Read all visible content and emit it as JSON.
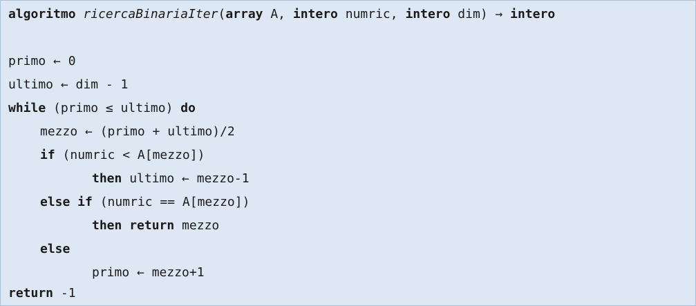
{
  "code": {
    "signature": {
      "kw_algoritmo": "algoritmo",
      "name": "ricercaBinariaIter",
      "open_paren": "(",
      "kw_array": "array",
      "p1_name": " A, ",
      "kw_intero1": "intero",
      "p2_name": " numric, ",
      "kw_intero2": "intero",
      "p3_name": " dim) → ",
      "kw_intero_ret": "intero"
    },
    "line_primo": "primo ← 0",
    "line_ultimo": "ultimo ← dim - 1",
    "while_line": {
      "kw_while": "while",
      "cond": " (primo ≤ ultimo) ",
      "kw_do": "do"
    },
    "line_mezzo": "mezzo ← (primo + ultimo)/2",
    "if_line": {
      "kw_if": "if",
      "cond": " (numric < A[mezzo])"
    },
    "then1_line": {
      "kw_then": "then",
      "stmt": " ultimo ← mezzo-1"
    },
    "elseif_line": {
      "kw_else_if": "else if",
      "cond": " (numric == A[mezzo])"
    },
    "then2_line": {
      "kw_then": "then",
      "kw_return": "return",
      "stmt": " mezzo"
    },
    "else_line": {
      "kw_else": "else"
    },
    "line_primo_inc": "primo ← mezzo+1",
    "return_line": {
      "kw_return": "return",
      "value": " -1"
    }
  }
}
